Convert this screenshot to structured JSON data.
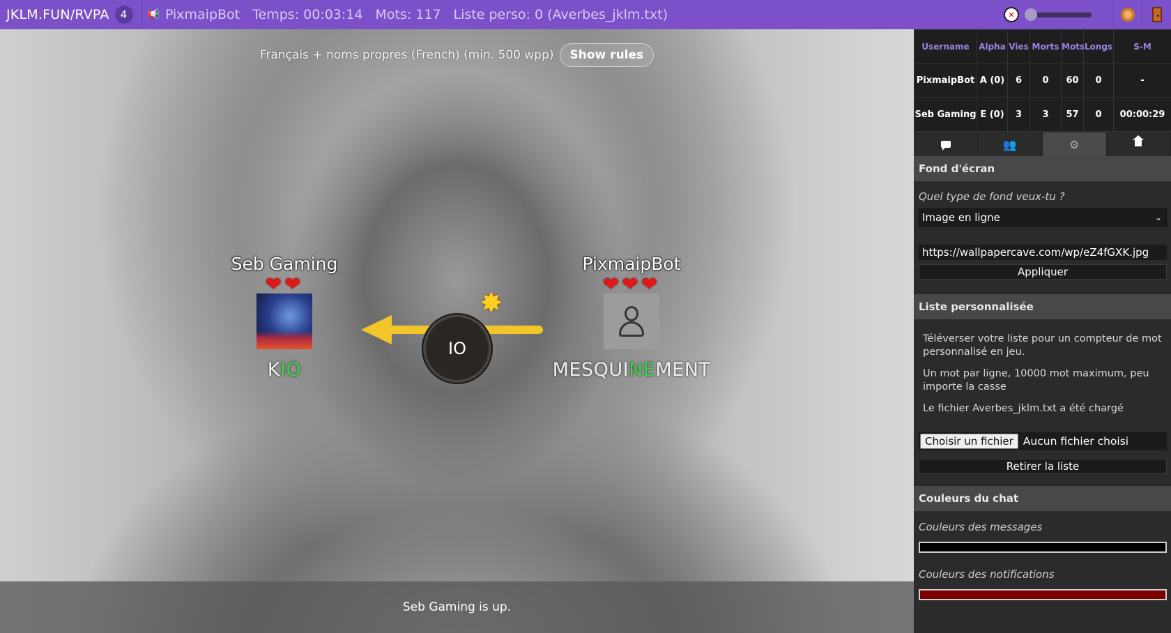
{
  "topbar": {
    "room": "JKLM.FUN/RVPA",
    "player_count": "4",
    "bot_name": "PixmaipBot",
    "time": "Temps: 00:03:14",
    "words": "Mots: 117",
    "custom_list": "Liste perso: 0 (Averbes_jklm.txt)",
    "volume": 0.05
  },
  "game": {
    "rules_text": "Français + noms propres (French) (min. 500 wpp)",
    "rules_button": "Show rules",
    "syllable": "IO",
    "status": "Seb Gaming is up.",
    "players": [
      {
        "name": "Seb Gaming",
        "lives": "❤❤",
        "word_before": "K",
        "word_highlight": "IO",
        "word_after": ""
      },
      {
        "name": "PixmaipBot",
        "lives": "❤❤❤",
        "word_before": "MESQUI",
        "word_highlight": "NE",
        "word_after": "MENT"
      }
    ]
  },
  "scoreboard": {
    "headers": [
      "Username",
      "Alpha",
      "Vies",
      "Morts",
      "Mots",
      "Longs",
      "S-M"
    ],
    "rows": [
      [
        "PixmaipBot",
        "A (0)",
        "6",
        "0",
        "60",
        "0",
        "-"
      ],
      [
        "Seb Gaming",
        "E (0)",
        "3",
        "3",
        "57",
        "0",
        "00:00:29"
      ]
    ]
  },
  "tabs": [
    {
      "icon": "chat-icon"
    },
    {
      "icon": "people-icon"
    },
    {
      "icon": "gear-icon",
      "active": true
    },
    {
      "icon": "home-icon"
    }
  ],
  "settings": {
    "background": {
      "title": "Fond d'écran",
      "question": "Quel type de fond veux-tu ?",
      "select_value": "Image en ligne",
      "url": "https://wallpapercave.com/wp/eZ4fGXK.jpg",
      "apply": "Appliquer"
    },
    "custom_list": {
      "title": "Liste personnalisée",
      "p1": "Téléverser votre liste pour un compteur de mot personnalisé en jeu.",
      "p2": "Un mot par ligne, 10000 mot maximum, peu importe la casse",
      "p3": "Le fichier Averbes_jklm.txt a été chargé",
      "choose_file": "Choisir un fichier",
      "no_file": "Aucun fichier choisi",
      "remove": "Retirer la liste"
    },
    "chat_colors": {
      "title": "Couleurs du chat",
      "messages_label": "Couleurs des messages",
      "messages_color": "#000000",
      "notifications_label": "Couleurs des notifications",
      "notifications_color": "#7a0000"
    }
  }
}
